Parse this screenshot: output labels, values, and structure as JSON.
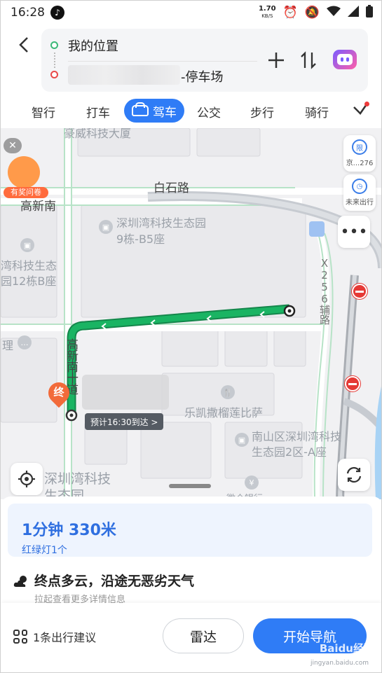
{
  "status_bar": {
    "time": "16:28",
    "speed_value": "1.70",
    "speed_unit": "KB/S"
  },
  "header": {
    "origin": "我的位置",
    "destination_suffix": "-停车场",
    "add_icon": "plus-icon",
    "swap_icon": "swap-icon"
  },
  "tabs": [
    {
      "label": "智行"
    },
    {
      "label": "打车"
    },
    {
      "label": "驾车",
      "active": true
    },
    {
      "label": "公交"
    },
    {
      "label": "步行"
    },
    {
      "label": "骑行"
    }
  ],
  "map": {
    "labels": {
      "company": "豪威科技大厦",
      "road_baishi": "白石路",
      "gaoxinnan_top": "高新南",
      "park_b5_l1": "深圳湾科技生态园",
      "park_b5_l2": "9栋-B5座",
      "park_12_l1": "湾科技生态",
      "park_12_l2": "园12栋B座",
      "road_vertical": "高新南十道",
      "road_x256": "X256辅路",
      "li": "理",
      "restaurant": "乐凯撒榴莲比萨",
      "park_2a_l1": "南山区深圳湾科技",
      "park_2a_l2": "生态园2区-A座",
      "park_bottom": "深圳湾科技",
      "park_bottom2": "生态园",
      "bank_text": "微众银行"
    },
    "side_controls": {
      "plate": "京...276",
      "future": "未来出行"
    },
    "survey_label": "有奖问卷",
    "end_marker": "终",
    "eta_tag": "预计16:30到达 >"
  },
  "route": {
    "duration_distance": "1分钟  330米",
    "traffic_lights": "红绿灯1个"
  },
  "weather": {
    "text": "终点多云，沿途无恶劣天气",
    "hint": "拉起查看更多详情信息"
  },
  "footer": {
    "suggestion": "1条出行建议",
    "radar": "雷达",
    "start_nav": "开始导航",
    "watermark": "Baidu经验",
    "watermark_url": "jingyan.baidu.com"
  },
  "colors": {
    "accent": "#2f7cf6",
    "route_green": "#1aa05a",
    "no_entry_red": "#e53935"
  }
}
